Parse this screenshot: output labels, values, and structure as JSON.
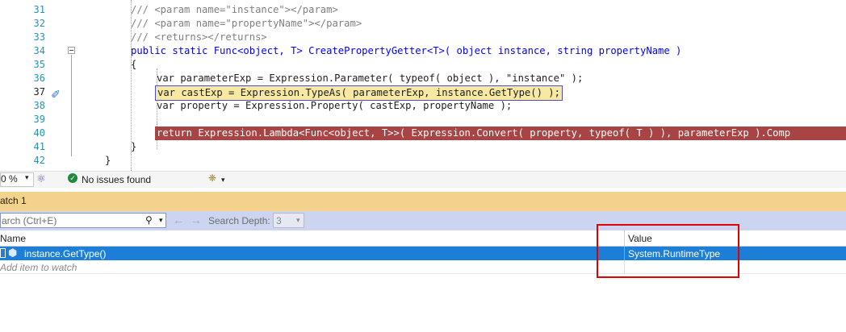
{
  "editor": {
    "lines": [
      {
        "num": "31",
        "text": "/// <param name=\"instance\"></param>"
      },
      {
        "num": "32",
        "text": "/// <param name=\"propertyName\"></param>"
      },
      {
        "num": "33",
        "text": "/// <returns></returns>"
      },
      {
        "num": "34",
        "text": "public static Func<object, T> CreatePropertyGetter<T>( object instance, string propertyName )"
      },
      {
        "num": "35",
        "text": "{"
      },
      {
        "num": "36",
        "text": "var parameterExp = Expression.Parameter( typeof( object ), \"instance\" );"
      },
      {
        "num": "37",
        "text": "var castExp = Expression.TypeAs( parameterExp, instance.GetType() );"
      },
      {
        "num": "38",
        "text": "var property = Expression.Property( castExp, propertyName );"
      },
      {
        "num": "39",
        "text": ""
      },
      {
        "num": "40",
        "text": "return Expression.Lambda<Func<object, T>>( Expression.Convert( property, typeof( T ) ), parameterExp ).Comp"
      },
      {
        "num": "41",
        "text": "}"
      },
      {
        "num": "42",
        "text": "}"
      }
    ]
  },
  "status": {
    "zoom": "0 %",
    "issues": "No issues found"
  },
  "watch": {
    "title": "atch 1",
    "search_placeholder": "arch (Ctrl+E)",
    "search_depth_label": "Search Depth:",
    "search_depth_value": "3",
    "col_name": "Name",
    "col_value": "Value",
    "rows": [
      {
        "name": "instance.GetType()",
        "value": "System.RuntimeType"
      }
    ],
    "add_item": "Add item to watch"
  },
  "colors": {
    "accent": "#1c7ed6",
    "current_line": "#f7e9a1",
    "breakpoint_line": "#a84444",
    "highlight_box": "#e00000"
  }
}
